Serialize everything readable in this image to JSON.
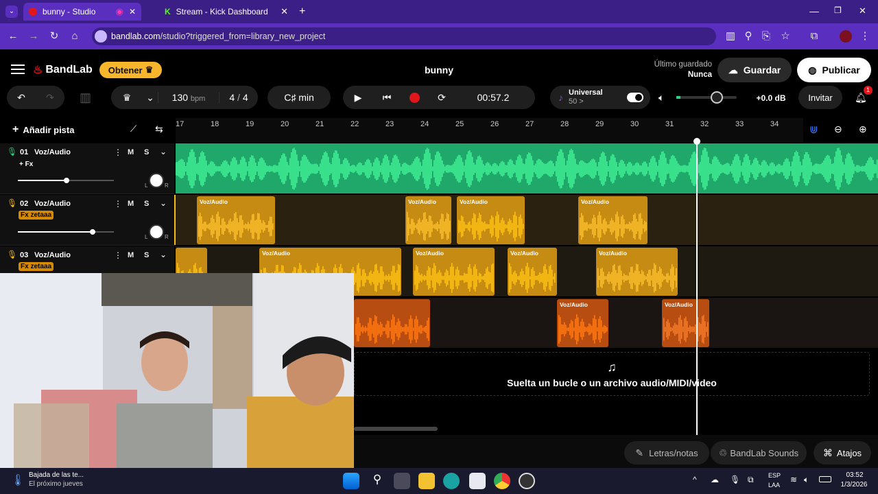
{
  "browser": {
    "tabs": [
      {
        "label": "bunny - Studio",
        "active": true
      },
      {
        "label": "Stream - Kick Dashboard",
        "active": false
      }
    ],
    "url_host": "bandlab.com",
    "url_path": "/studio?triggered_from=library_new_project",
    "new_tab": "+"
  },
  "app": {
    "logo": "BandLab",
    "obtener": "Obtener",
    "project_title": "bunny",
    "last_saved_label": "Último guardado",
    "last_saved_value": "Nunca",
    "save_label": "Guardar",
    "publish_label": "Publicar"
  },
  "transport": {
    "bpm": "130",
    "bpm_unit": "bpm",
    "time_sig_num": "4",
    "time_sig_sep": "/",
    "time_sig_den": "4",
    "key": "C♯ min",
    "time": "00:57.2",
    "universal_label": "Universal",
    "universal_value": "50 >",
    "volume_db": "+0.0 dB",
    "invite_label": "Invitar",
    "notif_count": "1"
  },
  "timeline": {
    "add_track_label": "Añadir pista",
    "bars": [
      "17",
      "18",
      "19",
      "20",
      "21",
      "22",
      "23",
      "24",
      "25",
      "26",
      "27",
      "28",
      "29",
      "30",
      "31",
      "32",
      "33",
      "34"
    ]
  },
  "tracks": [
    {
      "num": "01",
      "name": "Voz/Audio",
      "fx": "+ Fx",
      "m": "M",
      "s": "S"
    },
    {
      "num": "02",
      "name": "Voz/Audio",
      "fx": "Fx zetaaa",
      "m": "M",
      "s": "S"
    },
    {
      "num": "03",
      "name": "Voz/Audio",
      "fx": "Fx zetaaa",
      "m": "M",
      "s": "S"
    }
  ],
  "clip_label": "Voz/Audio",
  "pan_l": "L",
  "pan_r": "R",
  "drop_zone": "Suelta un bucle o un archivo audio/MIDI/video",
  "bottom": {
    "lyrics": "Letras/notas",
    "sounds": "BandLab Sounds",
    "shortcuts": "Atajos"
  },
  "taskbar": {
    "weather_line1": "Bajada de las te...",
    "weather_line2": "El próximo jueves",
    "lang_line1": "ESP",
    "lang_line2": "LAA",
    "time": "03:52",
    "date": "1/3/2026"
  },
  "colors": {
    "browser_purple": "#5a2fc0",
    "track1_green": "#2fd185",
    "track2_yellow": "#f5b91a",
    "track4_orange": "#ff6a13",
    "accent_red": "#e0161b"
  }
}
